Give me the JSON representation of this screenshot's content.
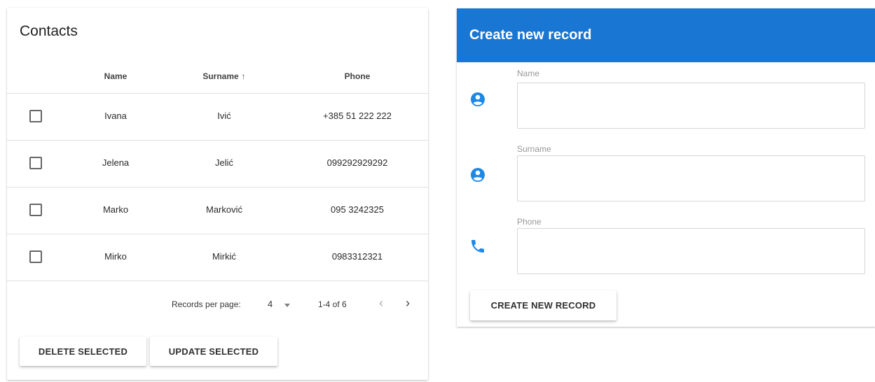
{
  "contacts": {
    "title": "Contacts",
    "columns": {
      "name": "Name",
      "surname": "Surname",
      "sort_arrow": "↑",
      "phone": "Phone"
    },
    "rows": [
      {
        "name": "Ivana",
        "surname": "Ivić",
        "phone": "+385 51 222 222"
      },
      {
        "name": "Jelena",
        "surname": "Jelić",
        "phone": "099292929292"
      },
      {
        "name": "Marko",
        "surname": "Marković",
        "phone": "095 3242325"
      },
      {
        "name": "Mirko",
        "surname": "Mirkić",
        "phone": "0983312321"
      }
    ],
    "pagination": {
      "rows_per_page_label": "Records per page:",
      "rows_per_page_value": "4",
      "range_text": "1-4 of 6",
      "prev_glyph": "‹",
      "next_glyph": "›"
    },
    "buttons": {
      "delete": "DELETE SELECTED",
      "update": "UPDATE SELECTED"
    }
  },
  "create_form": {
    "title": "Create new record",
    "fields": [
      {
        "label": "Name",
        "icon": "account-circle-icon",
        "value": ""
      },
      {
        "label": "Surname",
        "icon": "account-circle-icon",
        "value": ""
      },
      {
        "label": "Phone",
        "icon": "phone-icon",
        "value": ""
      }
    ],
    "submit_label": "CREATE NEW RECORD"
  },
  "colors": {
    "primary": "#1976d2",
    "icon_blue": "#1e88e5"
  }
}
